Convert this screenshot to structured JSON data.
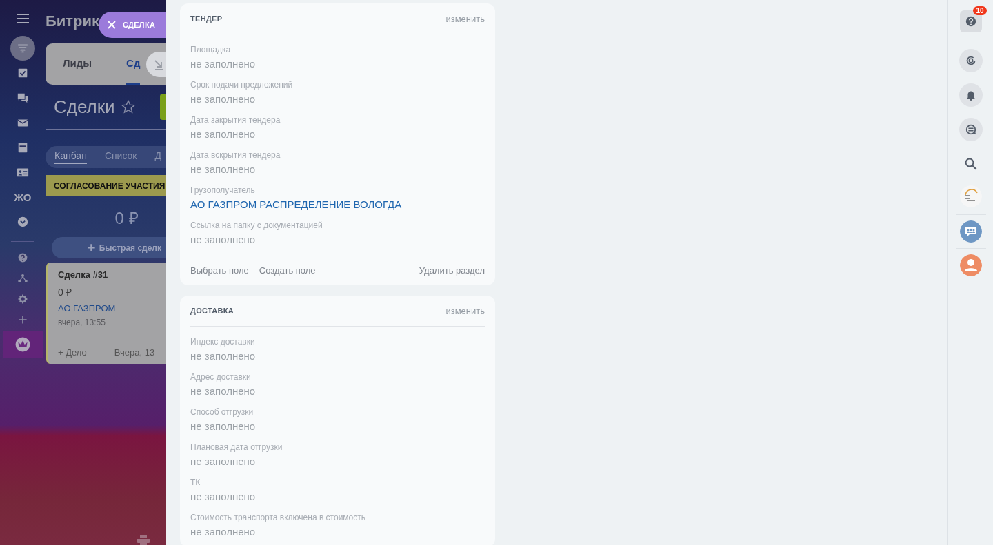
{
  "background_page": {
    "logo": "Битрик",
    "tabs": [
      {
        "label": "Лиды",
        "selected": false
      },
      {
        "label": "Сд",
        "selected": true
      }
    ],
    "title": "Сделки",
    "views": [
      {
        "label": "Канбан",
        "selected": true
      },
      {
        "label": "Список",
        "selected": false
      },
      {
        "label": "Д",
        "selected": false
      }
    ],
    "sidebar": {
      "items": [
        {
          "kind": "icon",
          "selected": true
        },
        {
          "kind": "icon",
          "selected": false
        },
        {
          "kind": "icon",
          "selected": false
        },
        {
          "kind": "icon",
          "selected": false
        },
        {
          "kind": "icon",
          "selected": false
        },
        {
          "kind": "icon",
          "selected": false
        },
        {
          "kind": "text",
          "label": "ЖО",
          "selected": false
        },
        {
          "kind": "icon",
          "selected": false
        }
      ],
      "bottom": [
        {
          "selected": false
        },
        {
          "selected": false
        },
        {
          "selected": false
        },
        {
          "selected": false
        },
        {
          "selected": true
        }
      ]
    },
    "column": {
      "title": "СОГЛАСОВАНИЕ УЧАСТИЯ",
      "color": "#9c9a4e",
      "sum": "0 ₽",
      "quick_add": "Быстрая сделк"
    },
    "deal_card": {
      "title": "Сделка #31",
      "amount": "0 ₽",
      "company": "АО ГАЗПРОМ",
      "date": "вчера, 13:55",
      "add_activity": "+ Дело",
      "activity_date": "Вчера, 13"
    }
  },
  "close_button": {
    "label": "СДЕЛКА"
  },
  "sections": [
    {
      "title": "ТЕНДЕР",
      "edit": "изменить",
      "fields": [
        {
          "label": "Площадка",
          "value": "не заполнено",
          "kind": "empty"
        },
        {
          "label": "Срок подачи предложений",
          "value": "не заполнено",
          "kind": "empty"
        },
        {
          "label": "Дата закрытия тендера",
          "value": "не заполнено",
          "kind": "empty"
        },
        {
          "label": "Дата вскрытия тендера",
          "value": "не заполнено",
          "kind": "empty"
        },
        {
          "label": "Грузополучатель",
          "value": "АО ГАЗПРОМ РАСПРЕДЕЛЕНИЕ ВОЛОГДА",
          "kind": "link"
        },
        {
          "label": "Ссылка на папку с документацией",
          "value": "не заполнено",
          "kind": "empty"
        }
      ],
      "actions": [
        "Выбрать поле",
        "Создать поле"
      ],
      "delete": "Удалить раздел"
    },
    {
      "title": "ДОСТАВКА",
      "edit": "изменить",
      "fields": [
        {
          "label": "Индекс доставки",
          "value": "не заполнено",
          "kind": "empty"
        },
        {
          "label": "Адрес доставки",
          "value": "не заполнено",
          "kind": "empty"
        },
        {
          "label": "Способ отгрузки",
          "value": "не заполнено",
          "kind": "empty"
        },
        {
          "label": "Плановая дата отгрузки",
          "value": "не заполнено",
          "kind": "empty"
        },
        {
          "label": "ТК",
          "value": "не заполнено",
          "kind": "empty"
        },
        {
          "label": "Стоимость транспорта включена в стоимость",
          "value": "не заполнено",
          "kind": "empty"
        }
      ]
    }
  ],
  "right_bar": {
    "help_badge": "10"
  }
}
